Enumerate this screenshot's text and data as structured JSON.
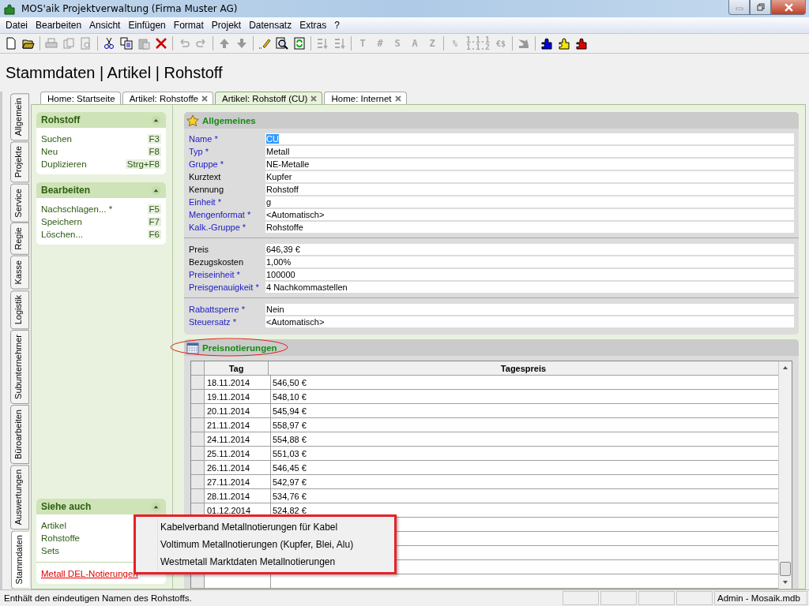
{
  "window": {
    "title": "MOS'aik Projektverwaltung (Firma Muster AG)"
  },
  "menu": [
    "Datei",
    "Bearbeiten",
    "Ansicht",
    "Einfügen",
    "Format",
    "Projekt",
    "Datensatz",
    "Extras",
    "?"
  ],
  "toolbar": {
    "letter_buttons": [
      {
        "label": "T",
        "disabled": true
      },
      {
        "label": "#",
        "disabled": true
      },
      {
        "label": "S",
        "disabled": true
      },
      {
        "label": "A",
        "disabled": true
      },
      {
        "label": "Z",
        "disabled": true
      }
    ],
    "number_buttons": [
      {
        "label": "%",
        "disabled": true
      },
      {
        "label": "1.1.1\n1.1.2",
        "disabled": true
      },
      {
        "label": "€$",
        "disabled": true
      }
    ]
  },
  "breadcrumb": "Stammdaten | Artikel | Rohstoff",
  "side_tabs": [
    {
      "label": "Allgemein",
      "selected": false
    },
    {
      "label": "Projekte",
      "selected": false
    },
    {
      "label": "Service",
      "selected": false
    },
    {
      "label": "Regie",
      "selected": false
    },
    {
      "label": "Kasse",
      "selected": false
    },
    {
      "label": "Logistik",
      "selected": false
    },
    {
      "label": "Subunternehmer",
      "selected": false
    },
    {
      "label": "Büroarbeiten",
      "selected": false
    },
    {
      "label": "Auswertungen",
      "selected": false
    },
    {
      "label": "Stammdaten",
      "selected": true
    }
  ],
  "doc_tabs": [
    {
      "label": "Home: Startseite",
      "selected": false,
      "closable": false
    },
    {
      "label": "Artikel: Rohstoffe",
      "selected": false,
      "closable": true
    },
    {
      "label": "Artikel: Rohstoff (CU)",
      "selected": true,
      "closable": true
    },
    {
      "label": "Home: Internet",
      "selected": false,
      "closable": true
    }
  ],
  "task_panels": [
    {
      "title": "Rohstoff",
      "items": [
        {
          "label": "Suchen",
          "shortcut": "F3"
        },
        {
          "label": "Neu",
          "shortcut": "F8"
        },
        {
          "label": "Duplizieren",
          "shortcut": "Strg+F8"
        }
      ]
    },
    {
      "title": "Bearbeiten",
      "items": [
        {
          "label": "Nachschlagen... *",
          "shortcut": "F5"
        },
        {
          "label": "Speichern",
          "shortcut": "F7"
        },
        {
          "label": "Löschen...",
          "shortcut": "F6"
        }
      ]
    }
  ],
  "see_also": {
    "title": "Siehe auch",
    "items": [
      "Artikel",
      "Rohstoffe",
      "Sets"
    ],
    "link": "Metall DEL-Notierungen"
  },
  "general": {
    "title": "Allgemeines",
    "groups": [
      [
        {
          "label": "Name *",
          "value": "CU",
          "required": true,
          "highlighted": true
        },
        {
          "label": "Typ *",
          "value": "Metall",
          "required": true,
          "highlighted": false
        },
        {
          "label": "Gruppe *",
          "value": "NE-Metalle",
          "required": true,
          "highlighted": false
        },
        {
          "label": "Kurztext",
          "value": "Kupfer",
          "required": false,
          "highlighted": false
        },
        {
          "label": "Kennung",
          "value": "Rohstoff",
          "required": false,
          "highlighted": false
        },
        {
          "label": "Einheit *",
          "value": "g",
          "required": true,
          "highlighted": false
        },
        {
          "label": "Mengenformat *",
          "value": "<Automatisch>",
          "required": true,
          "highlighted": false
        },
        {
          "label": "Kalk.-Gruppe *",
          "value": "Rohstoffe",
          "required": true,
          "highlighted": false
        }
      ],
      [
        {
          "label": "Preis",
          "value": "646,39 €",
          "required": false,
          "highlighted": false
        },
        {
          "label": "Bezugskosten",
          "value": "1,00%",
          "required": false,
          "highlighted": false
        },
        {
          "label": "Preiseinheit *",
          "value": "100000",
          "required": true,
          "highlighted": false
        },
        {
          "label": "Preisgenauigkeit *",
          "value": "4 Nachkommastellen",
          "required": true,
          "highlighted": false
        }
      ],
      [
        {
          "label": "Rabattsperre *",
          "value": "Nein",
          "required": true,
          "highlighted": false
        },
        {
          "label": "Steuersatz *",
          "value": "<Automatisch>",
          "required": true,
          "highlighted": false
        }
      ]
    ]
  },
  "quotes": {
    "title": "Preisnotierungen",
    "columns": [
      "Tag",
      "Tagespreis"
    ],
    "rows": [
      [
        "18.11.2014",
        "546,50 €"
      ],
      [
        "19.11.2014",
        "548,10 €"
      ],
      [
        "20.11.2014",
        "545,94 €"
      ],
      [
        "21.11.2014",
        "558,97 €"
      ],
      [
        "24.11.2014",
        "554,88 €"
      ],
      [
        "25.11.2014",
        "551,03 €"
      ],
      [
        "26.11.2014",
        "546,45 €"
      ],
      [
        "27.11.2014",
        "542,97 €"
      ],
      [
        "28.11.2014",
        "534,76 €"
      ],
      [
        "01.12.2014",
        "524,82 €"
      ]
    ]
  },
  "context_menu": [
    "Kabelverband Metallnotierungen für Kabel",
    "Voltimum Metallnotierungen (Kupfer, Blei, Alu)",
    "Westmetall Marktdaten Metallnotierungen"
  ],
  "status_bar": {
    "message": "Enthält den eindeutigen Namen des Rohstoffs.",
    "user": "Admin - Mosaik.mdb"
  }
}
